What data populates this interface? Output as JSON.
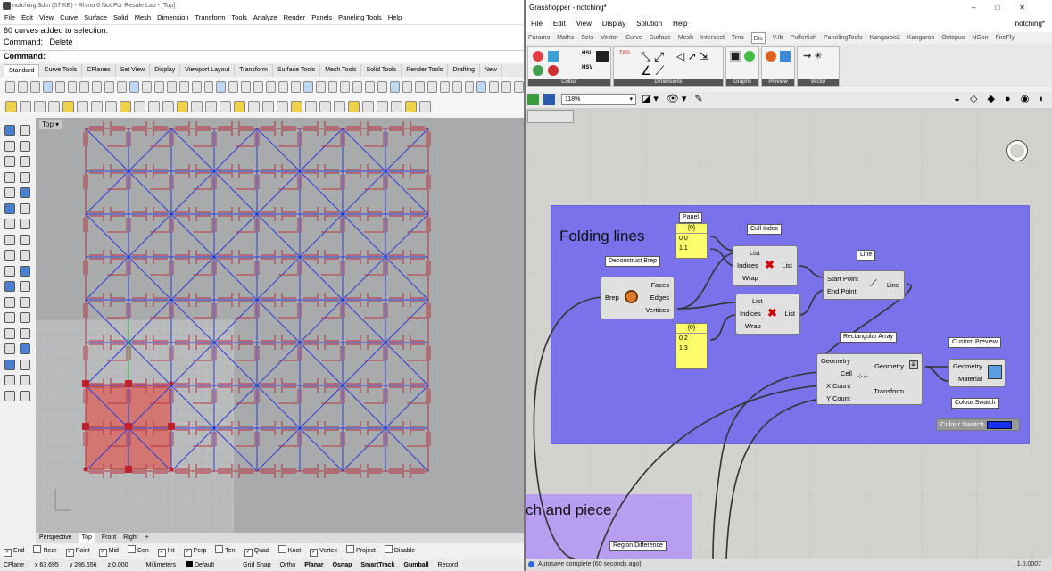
{
  "rhino": {
    "title": "notching.3dm (57 KB) - Rhino 6 Not For Resale Lab - [Top]",
    "menu": [
      "File",
      "Edit",
      "View",
      "Curve",
      "Surface",
      "Solid",
      "Mesh",
      "Dimension",
      "Transform",
      "Tools",
      "Analyze",
      "Render",
      "Panels",
      "Paneling Tools",
      "Help"
    ],
    "history": [
      "60 curves added to selection.",
      "Command: _Delete"
    ],
    "command_prompt": "Command:",
    "tabs": [
      "Standard",
      "Curve Tools",
      "CPlanes",
      "Set View",
      "Display",
      "Viewport Layout",
      "Transform",
      "Surface Tools",
      "Mesh Tools",
      "Solid Tools",
      "Render Tools",
      "Drafting",
      "New"
    ],
    "viewport_label": "Top",
    "viewport_tabs": [
      "Perspective",
      "Top",
      "Front",
      "Right"
    ],
    "viewport_add": "+",
    "osnaps": [
      {
        "label": "End",
        "checked": true
      },
      {
        "label": "Near",
        "checked": false
      },
      {
        "label": "Point",
        "checked": true
      },
      {
        "label": "Mid",
        "checked": true
      },
      {
        "label": "Cen",
        "checked": false
      },
      {
        "label": "Int",
        "checked": true
      },
      {
        "label": "Perp",
        "checked": true
      },
      {
        "label": "Ten",
        "checked": false
      },
      {
        "label": "Quad",
        "checked": true
      },
      {
        "label": "Knot",
        "checked": false
      },
      {
        "label": "Vertex",
        "checked": true
      },
      {
        "label": "Project",
        "checked": false
      },
      {
        "label": "Disable",
        "checked": false
      }
    ],
    "status": {
      "cplane": "CPlane",
      "x": "x 63.695",
      "y": "y 286.556",
      "z": "z 0.000",
      "units": "Millimeters",
      "layer": "Default",
      "items": [
        "Grid Snap",
        "Ortho",
        "Planar",
        "Osnap",
        "SmartTrack",
        "Gumball",
        "Record"
      ]
    },
    "colors": {
      "curve": "#b4303a",
      "fold": "#2c3cd8",
      "selection": "#d9655f"
    }
  },
  "gh": {
    "title": "Grasshopper - notching*",
    "menu": [
      "File",
      "Edit",
      "View",
      "Display",
      "Solution",
      "Help"
    ],
    "doc_name": "notching*",
    "tabs": [
      "Params",
      "Maths",
      "Sets",
      "Vector",
      "Curve",
      "Surface",
      "Mesh",
      "Intersect",
      "Trns",
      "Dis",
      "V.Ib",
      "Pufferfish",
      "PanelingTools",
      "Kangaroo2",
      "Kangaroo",
      "Octopus",
      "NGon",
      "FireFly"
    ],
    "ribbon_groups": [
      "Colour",
      "Dimensions",
      "Graphs",
      "Preview",
      "Vector"
    ],
    "zoom": "118%",
    "status": "Autosave complete (60 seconds ago)",
    "version": "1.0.0007",
    "group1_title": "Folding lines",
    "group2_title": "ch and piece",
    "components": {
      "panel1": {
        "caption": "Panel",
        "header": "{0}",
        "rows": [
          "0 0",
          "1 1"
        ]
      },
      "panel2": {
        "header": "{0}",
        "rows": [
          "0 2",
          "1 3"
        ]
      },
      "deconstruct": {
        "caption": "Deconstruct Brep",
        "input": "Brep",
        "outputs": [
          "Faces",
          "Edges",
          "Vertices"
        ]
      },
      "cull1": {
        "caption": "Cull Index",
        "inputs": [
          "List",
          "Indices",
          "Wrap"
        ],
        "output": "List"
      },
      "cull2": {
        "inputs": [
          "List",
          "Indices",
          "Wrap"
        ],
        "output": "List"
      },
      "line": {
        "caption": "Line",
        "inputs": [
          "Start Point",
          "End Point"
        ],
        "output": "Line"
      },
      "rect_array": {
        "caption": "Rectangular Array",
        "inputs": [
          "Geometry",
          "Cell",
          "X Count",
          "Y Count"
        ],
        "outputs": [
          "Geometry",
          "Transform"
        ]
      },
      "custom_preview": {
        "caption": "Custom Preview",
        "inputs": [
          "Geometry",
          "Material"
        ]
      },
      "swatch": {
        "caption": "Colour Swatch",
        "label": "Colour Swatch",
        "color": "#1433e6"
      },
      "region_diff": {
        "caption": "Region Difference"
      }
    },
    "colors": {
      "group1": "#7a72ea",
      "group2": "#b79ef0",
      "canvas": "#d2d3ce"
    }
  }
}
